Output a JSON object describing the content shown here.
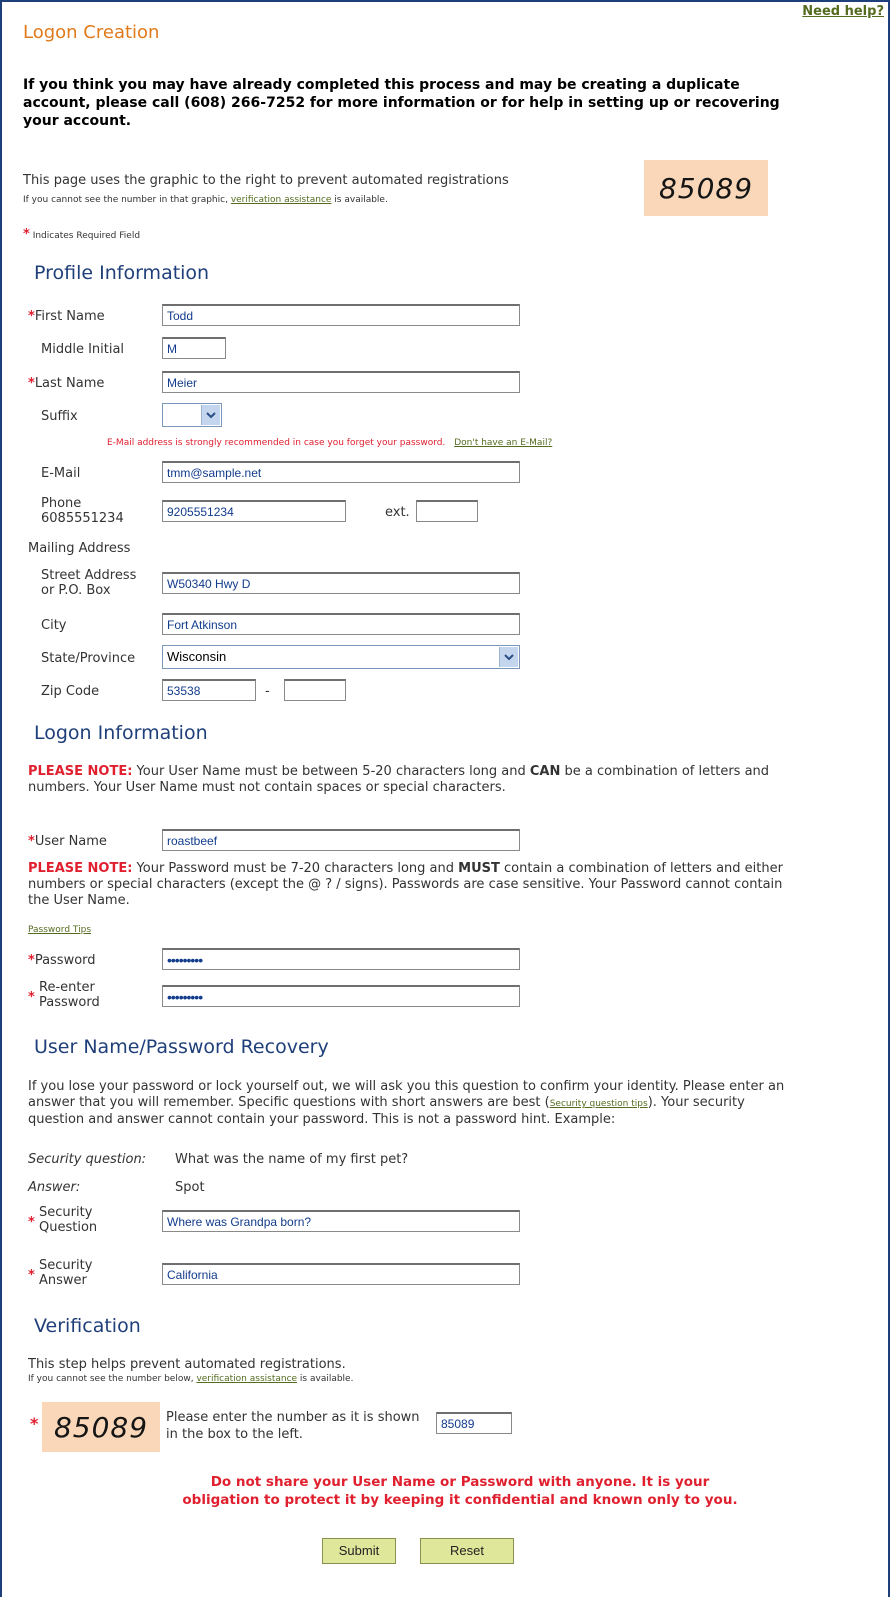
{
  "header": {
    "need_help": "Need help?",
    "title": "Logon Creation",
    "duplicate_warning": "If you think you may have already completed this process and may be creating a duplicate account, please call (608) 266-7252 for more information or for help in setting up or recovering your account."
  },
  "captcha_notice": {
    "text": "This page uses the graphic to the right to prevent automated registrations",
    "assist_prefix": "If you cannot see the number in that graphic, ",
    "assist_link": "verification assistance",
    "assist_suffix": " is available.",
    "captcha_value": "85089"
  },
  "required_note": {
    "star": "*",
    "text": "Indicates Required Field"
  },
  "profile": {
    "heading": "Profile Information",
    "first_name_label": "First Name",
    "first_name_value": "Todd",
    "middle_initial_label": "Middle Initial",
    "middle_initial_value": "M",
    "last_name_label": "Last Name",
    "last_name_value": "Meier",
    "suffix_label": "Suffix",
    "suffix_value": "",
    "email_recommend": "E-Mail address is strongly recommended in case you forget your password.",
    "no_email_link": "Don't have an E-Mail?",
    "email_label": "E-Mail",
    "email_value": "tmm@sample.net",
    "phone_label_1": "Phone",
    "phone_label_2": "6085551234",
    "phone_value": "9205551234",
    "ext_label": "ext.",
    "ext_value": "",
    "mailing_label": "Mailing Address",
    "street_label_1": "Street Address",
    "street_label_2": "or P.O. Box",
    "street_value": "W50340 Hwy D",
    "city_label": "City",
    "city_value": "Fort Atkinson",
    "state_label": "State/Province",
    "state_value": "Wisconsin",
    "zip_label": "Zip Code",
    "zip_value": "53538",
    "zip_dash": "-",
    "zip_ext_value": ""
  },
  "logon": {
    "heading": "Logon Information",
    "note1_prefix": "PLEASE NOTE:",
    "note1_a": " Your User Name must be between 5-20 characters long and ",
    "note1_bold": "CAN",
    "note1_b": " be a combination of letters and numbers. Your User Name must not contain spaces or special characters.",
    "username_label": "User Name",
    "username_value": "roastbeef",
    "note2_prefix": "PLEASE NOTE:",
    "note2_a": " Your Password must be 7-20 characters long and ",
    "note2_bold": "MUST",
    "note2_b": " contain a combination of letters and either numbers or special characters (except the @ ? / signs). Passwords are case sensitive. Your Password cannot contain the User Name.",
    "password_tips_link": "Password Tips",
    "password_label": "Password",
    "password_value": "•••••••••",
    "reenter_label_1": "Re-enter",
    "reenter_label_2": "Password",
    "reenter_value": "•••••••••"
  },
  "recovery": {
    "heading": "User Name/Password Recovery",
    "desc_a": "If you lose your password or lock yourself out, we will ask you this question to confirm your identity. Please enter an answer that you will remember. Specific questions with short answers are best (",
    "tips_link": "Security question tips",
    "desc_b": "). Your security question and answer cannot contain your password. This is not a password hint. Example:",
    "example_q_label": "Security question:",
    "example_q_value": "What was the name of my first pet?",
    "example_a_label": "Answer:",
    "example_a_value": "Spot",
    "question_label_1": "Security",
    "question_label_2": "Question",
    "question_value": "Where was Grandpa born?",
    "answer_label_1": "Security",
    "answer_label_2": "Answer",
    "answer_value": "California"
  },
  "verification": {
    "heading": "Verification",
    "desc": "This step helps prevent automated registrations.",
    "assist_prefix": "If you cannot see the number below, ",
    "assist_link": "verification assistance",
    "assist_suffix": " is available.",
    "captcha_value": "85089",
    "instruction": "Please enter the number as it is shown in the box to the left.",
    "input_value": "85089"
  },
  "footer": {
    "warning": "Do not share your User Name or Password with anyone.  It is your obligation to protect it by keeping it confidential and known only to you.",
    "submit_label": "Submit",
    "reset_label": "Reset"
  },
  "colors": {
    "title_orange": "#e07a1b",
    "section_blue": "#1f3f7a",
    "required_red": "#e0202f",
    "link_olive": "#556b1f",
    "button_green": "#dfe79a",
    "captcha_bg": "#f9d7b8"
  }
}
